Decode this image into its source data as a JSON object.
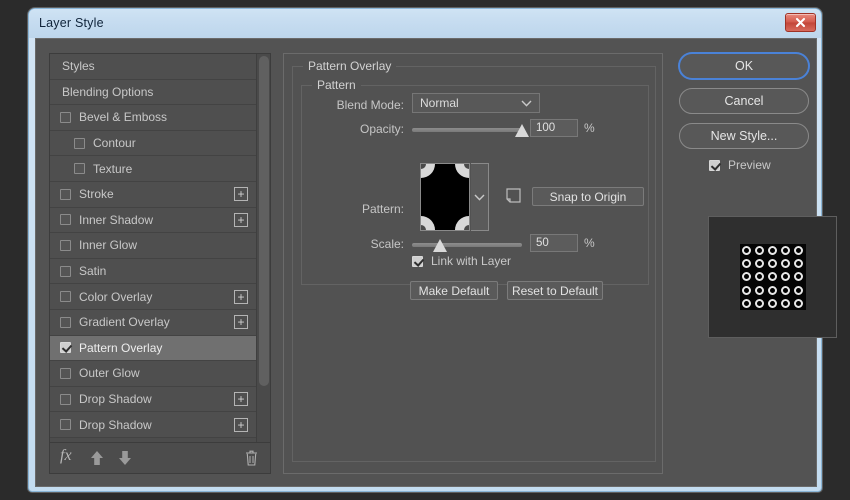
{
  "window": {
    "title": "Layer Style",
    "close_icon": "close-x-icon"
  },
  "styles_panel": {
    "items": [
      {
        "label": "Styles",
        "type": "header",
        "checkbox": null,
        "plus": false
      },
      {
        "label": "Blending Options",
        "type": "header",
        "checkbox": null,
        "plus": false
      },
      {
        "label": "Bevel & Emboss",
        "type": "item",
        "checkbox": false,
        "plus": false
      },
      {
        "label": "Contour",
        "type": "sub",
        "checkbox": false,
        "plus": false
      },
      {
        "label": "Texture",
        "type": "sub",
        "checkbox": false,
        "plus": false
      },
      {
        "label": "Stroke",
        "type": "item",
        "checkbox": false,
        "plus": true
      },
      {
        "label": "Inner Shadow",
        "type": "item",
        "checkbox": false,
        "plus": true
      },
      {
        "label": "Inner Glow",
        "type": "item",
        "checkbox": false,
        "plus": false
      },
      {
        "label": "Satin",
        "type": "item",
        "checkbox": false,
        "plus": false
      },
      {
        "label": "Color Overlay",
        "type": "item",
        "checkbox": false,
        "plus": true
      },
      {
        "label": "Gradient Overlay",
        "type": "item",
        "checkbox": false,
        "plus": true
      },
      {
        "label": "Pattern Overlay",
        "type": "item",
        "checkbox": true,
        "plus": false,
        "selected": true
      },
      {
        "label": "Outer Glow",
        "type": "item",
        "checkbox": false,
        "plus": false
      },
      {
        "label": "Drop Shadow",
        "type": "item",
        "checkbox": false,
        "plus": true
      },
      {
        "label": "Drop Shadow",
        "type": "item",
        "checkbox": false,
        "plus": true
      }
    ],
    "footer": {
      "fx_label": "fx",
      "fx_icon": "fx-menu-icon",
      "up_icon": "arrow-up-icon",
      "down_icon": "arrow-down-icon",
      "delete_icon": "trash-icon"
    }
  },
  "options": {
    "group_title": "Pattern Overlay",
    "subgroup_title": "Pattern",
    "blend_mode": {
      "label": "Blend Mode:",
      "value": "Normal",
      "chevron_icon": "chevron-down-icon"
    },
    "opacity": {
      "label": "Opacity:",
      "value": "100",
      "unit": "%",
      "slider_percent": 100
    },
    "pattern": {
      "label": "Pattern:",
      "swatch_icon": "pattern-swatch-thumbnail",
      "chevron_icon": "chevron-down-icon",
      "new_preset_icon": "new-preset-icon",
      "snap_button": "Snap to Origin"
    },
    "scale": {
      "label": "Scale:",
      "value": "50",
      "unit": "%",
      "slider_percent": 25
    },
    "link_with_layer": {
      "label": "Link with Layer",
      "checked": true
    },
    "make_default": "Make Default",
    "reset_to_default": "Reset to Default"
  },
  "actions": {
    "ok": "OK",
    "cancel": "Cancel",
    "new_style": "New Style...",
    "preview": {
      "label": "Preview",
      "checked": true
    }
  },
  "colors": {
    "dialog_bg": "#535353",
    "panel_bg": "#4c4c4c",
    "selected_row": "#707070",
    "focus_ring": "#4a82d8",
    "titlebar": "#c6dcf0",
    "close_red": "#c24538"
  }
}
